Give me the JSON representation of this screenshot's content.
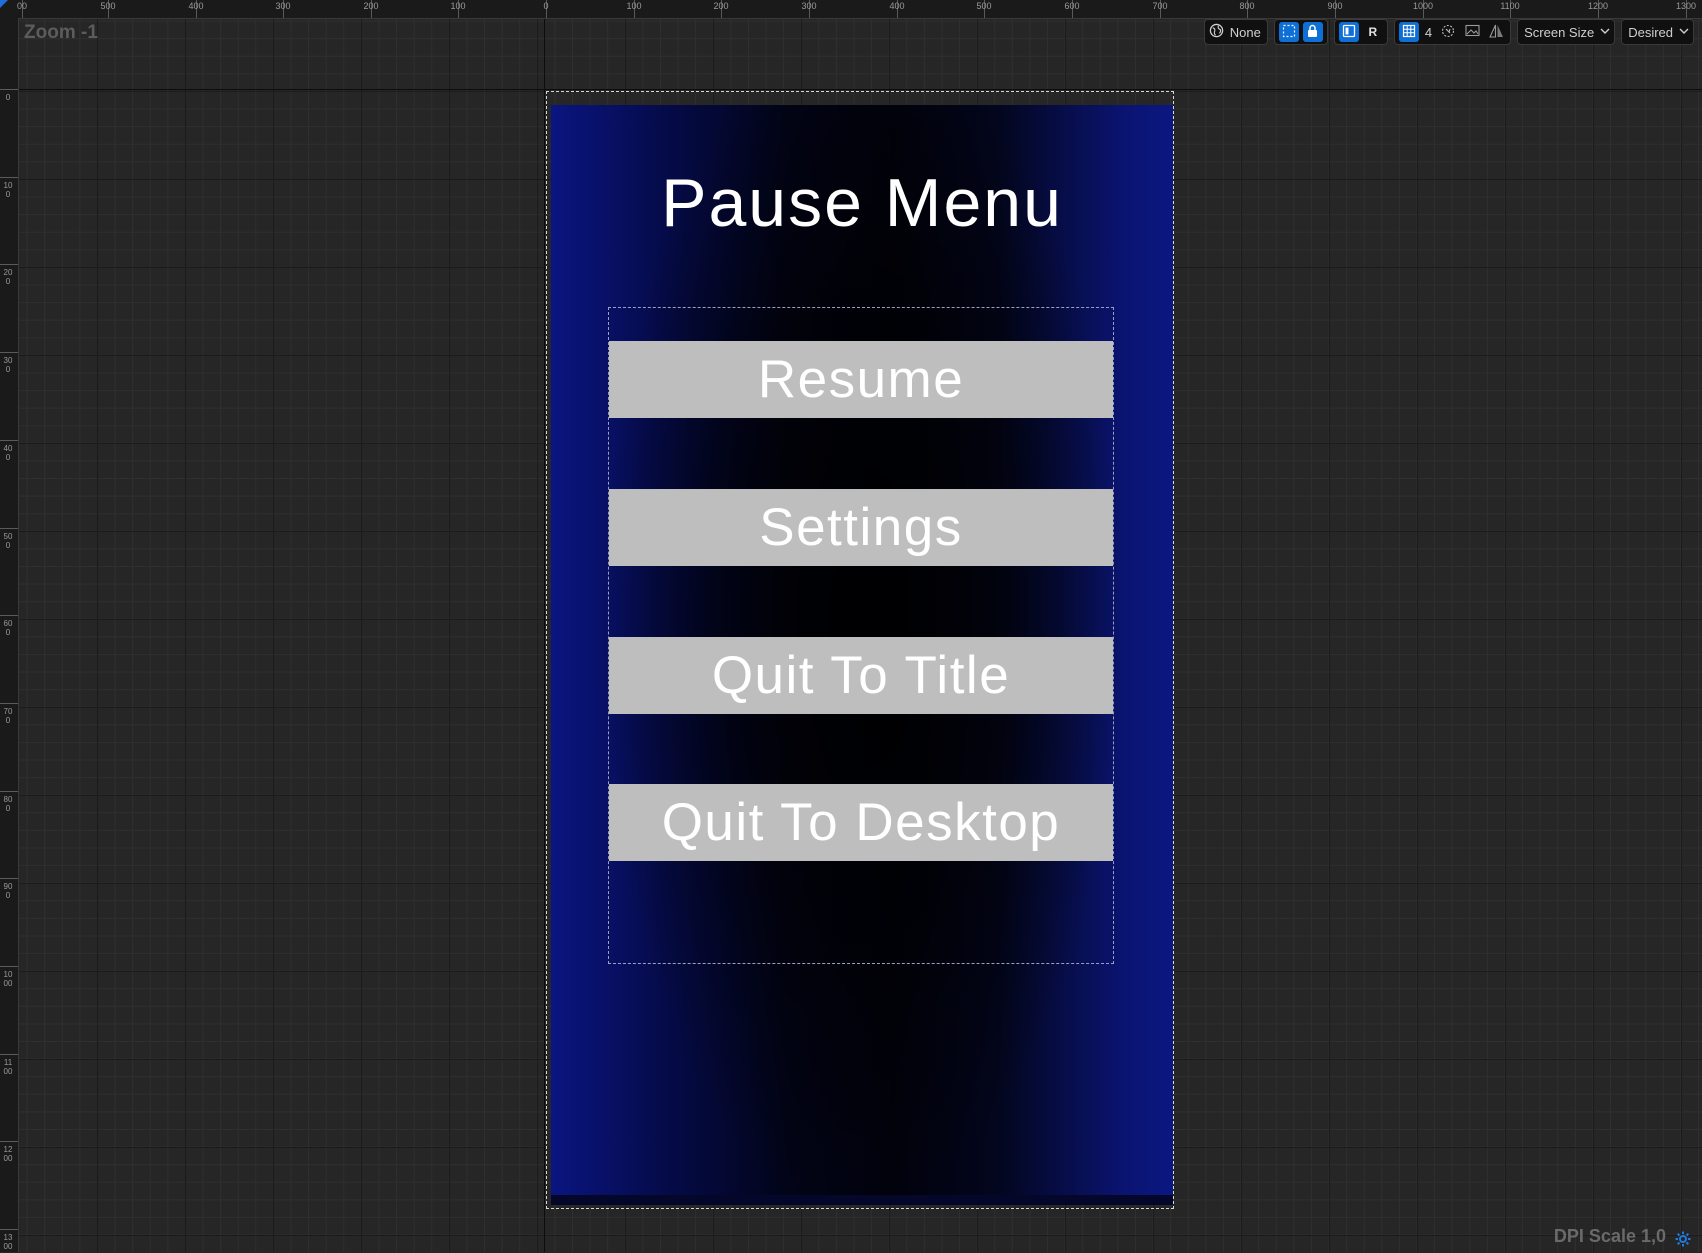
{
  "app": {
    "zoom_label": "Zoom -1",
    "dpi_label": "DPI Scale 1,0"
  },
  "rulers": {
    "top_labels": [
      "00",
      "500",
      "400",
      "300",
      "200",
      "100",
      "0",
      "100",
      "200",
      "300",
      "400",
      "500",
      "600",
      "700",
      "800",
      "900",
      "1000",
      "1100",
      "1200",
      "1300"
    ],
    "left_labels": [
      "0",
      "100",
      "200",
      "300",
      "400",
      "500",
      "600",
      "700",
      "800",
      "900",
      "1000",
      "1100",
      "1200",
      "1300"
    ]
  },
  "toolbar": {
    "world_label": "None",
    "respect_locks_label": "R",
    "grid_snap_value": "4",
    "screen_size_label": "Screen Size",
    "fill_mode_label": "Desired",
    "accent_color": "#0e6fd6",
    "icons": [
      "globe-icon",
      "transform-mode-icon",
      "lock-icon",
      "layout-icon",
      "grid-icon",
      "safe-zone-icon",
      "preview-image-icon",
      "flip-icon",
      "chevron-down-icon",
      "settings-gear-icon"
    ]
  },
  "widget": {
    "title": "Pause Menu",
    "buttons": [
      {
        "label": "Resume"
      },
      {
        "label": "Settings"
      },
      {
        "label": "Quit To Title"
      },
      {
        "label": "Quit To Desktop"
      }
    ],
    "button_color": "#bebebe",
    "background_accent": "#0a1580"
  }
}
